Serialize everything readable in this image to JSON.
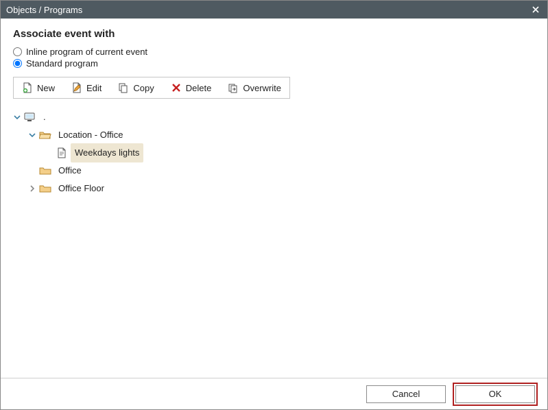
{
  "window": {
    "title": "Objects / Programs"
  },
  "heading": "Associate event with",
  "radios": {
    "inline": "Inline program of current event",
    "standard": "Standard program",
    "selected": "standard"
  },
  "toolbar": {
    "new": "New",
    "edit": "Edit",
    "copy": "Copy",
    "delete": "Delete",
    "overwrite": "Overwrite"
  },
  "tree": {
    "root": ".",
    "items": [
      {
        "label": "Location - Office",
        "type": "folder",
        "expanded": true,
        "indent": 1,
        "children": [
          {
            "label": "Weekdays lights",
            "type": "program",
            "selected": true,
            "indent": 2
          }
        ]
      },
      {
        "label": "Office",
        "type": "folder",
        "expanded": false,
        "indent": 1,
        "noTwisty": true
      },
      {
        "label": "Office Floor",
        "type": "folder",
        "expanded": false,
        "indent": 1
      }
    ]
  },
  "footer": {
    "cancel": "Cancel",
    "ok": "OK"
  }
}
